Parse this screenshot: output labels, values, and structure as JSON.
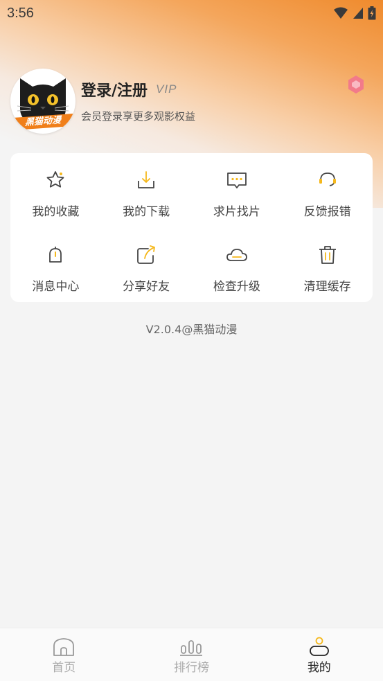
{
  "status_bar": {
    "time": "3:56"
  },
  "profile": {
    "avatar_banner": "黑猫动漫",
    "login_label": "登录/注册",
    "vip_label": "VIP",
    "member_hint": "会员登录享更多观影权益"
  },
  "menu": {
    "items": [
      {
        "label": "我的收藏",
        "icon": "star-icon"
      },
      {
        "label": "我的下载",
        "icon": "download-icon"
      },
      {
        "label": "求片找片",
        "icon": "message-icon"
      },
      {
        "label": "反馈报错",
        "icon": "headset-icon"
      },
      {
        "label": "消息中心",
        "icon": "bell-icon"
      },
      {
        "label": "分享好友",
        "icon": "share-icon"
      },
      {
        "label": "检查升级",
        "icon": "cloud-icon"
      },
      {
        "label": "清理缓存",
        "icon": "trash-icon"
      }
    ]
  },
  "version": "V2.0.4@黑猫动漫",
  "tabbar": {
    "tabs": [
      {
        "label": "首页",
        "icon": "home-icon",
        "active": false
      },
      {
        "label": "排行榜",
        "icon": "ranking-icon",
        "active": false
      },
      {
        "label": "我的",
        "icon": "person-icon",
        "active": true
      }
    ]
  },
  "colors": {
    "accent": "#f5b81c",
    "orange": "#ef8a2c",
    "icon_stroke": "#444444"
  }
}
